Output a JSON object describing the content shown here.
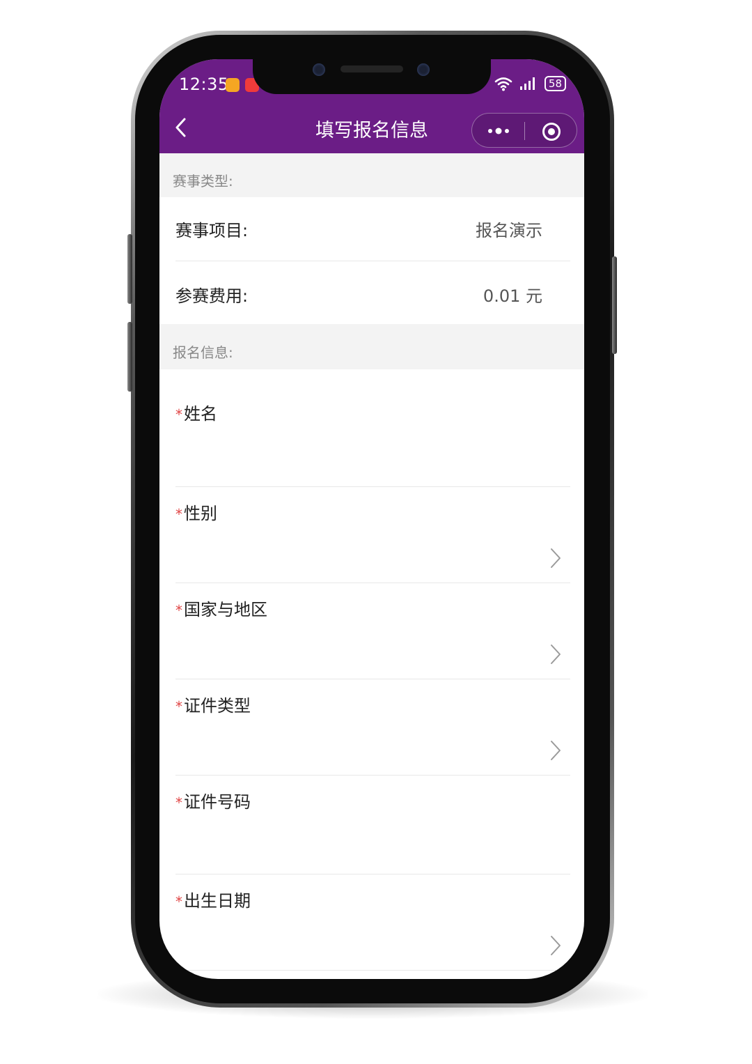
{
  "status_bar": {
    "time": "12:35",
    "battery": "58"
  },
  "nav": {
    "title": "填写报名信息",
    "back_icon": "chevron-left-icon",
    "more_icon": "more-dots-icon",
    "close_icon": "target-circle-icon"
  },
  "colors": {
    "header_bg": "#6b1d86",
    "required_mark": "#e04646",
    "section_bg": "#f3f3f3"
  },
  "event_section": {
    "title": "赛事类型:",
    "items": [
      {
        "label": "赛事项目:",
        "value": "报名演示"
      },
      {
        "label": "参赛费用:",
        "value": "0.01 元"
      }
    ]
  },
  "signup_section": {
    "title": "报名信息:",
    "required_mark": "*",
    "fields": [
      {
        "label": "姓名"
      },
      {
        "label": "性别"
      },
      {
        "label": "国家与地区"
      },
      {
        "label": "证件类型"
      },
      {
        "label": "证件号码"
      },
      {
        "label": "出生日期"
      }
    ]
  }
}
